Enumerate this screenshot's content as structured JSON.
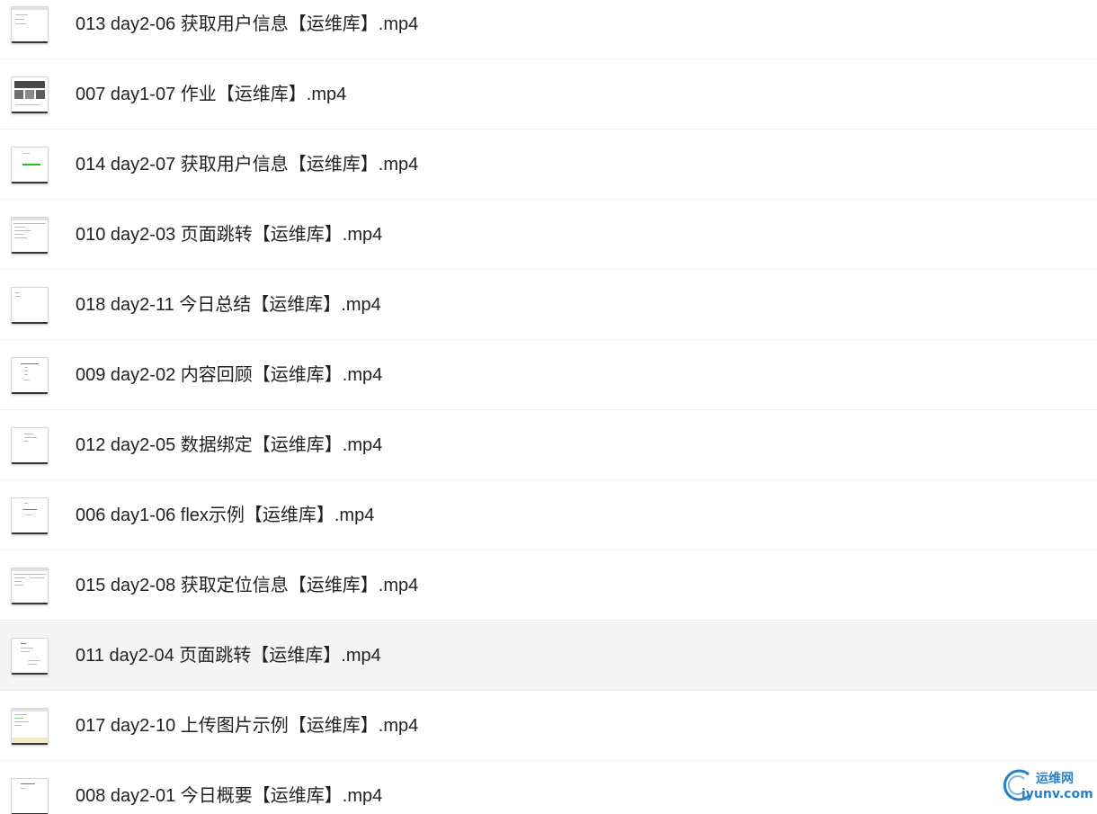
{
  "files": [
    {
      "name": "013 day2-06 获取用户信息【运维库】.mp4"
    },
    {
      "name": "007 day1-07 作业【运维库】.mp4"
    },
    {
      "name": "014 day2-07 获取用户信息【运维库】.mp4"
    },
    {
      "name": "010 day2-03 页面跳转【运维库】.mp4"
    },
    {
      "name": "018 day2-11 今日总结【运维库】.mp4"
    },
    {
      "name": "009 day2-02 内容回顾【运维库】.mp4"
    },
    {
      "name": "012 day2-05 数据绑定【运维库】.mp4"
    },
    {
      "name": "006 day1-06 flex示例【运维库】.mp4"
    },
    {
      "name": "015 day2-08 获取定位信息【运维库】.mp4"
    },
    {
      "name": "011 day2-04 页面跳转【运维库】.mp4"
    },
    {
      "name": "017 day2-10 上传图片示例【运维库】.mp4"
    },
    {
      "name": "008 day2-01 今日概要【运维库】.mp4"
    }
  ],
  "hovered_index": 9,
  "watermark": {
    "top": "运维网",
    "bottom": "iyunv.com",
    "color": "#2a7fc6"
  },
  "icons": {
    "file_thumbnail": "video-thumbnail-icon"
  }
}
